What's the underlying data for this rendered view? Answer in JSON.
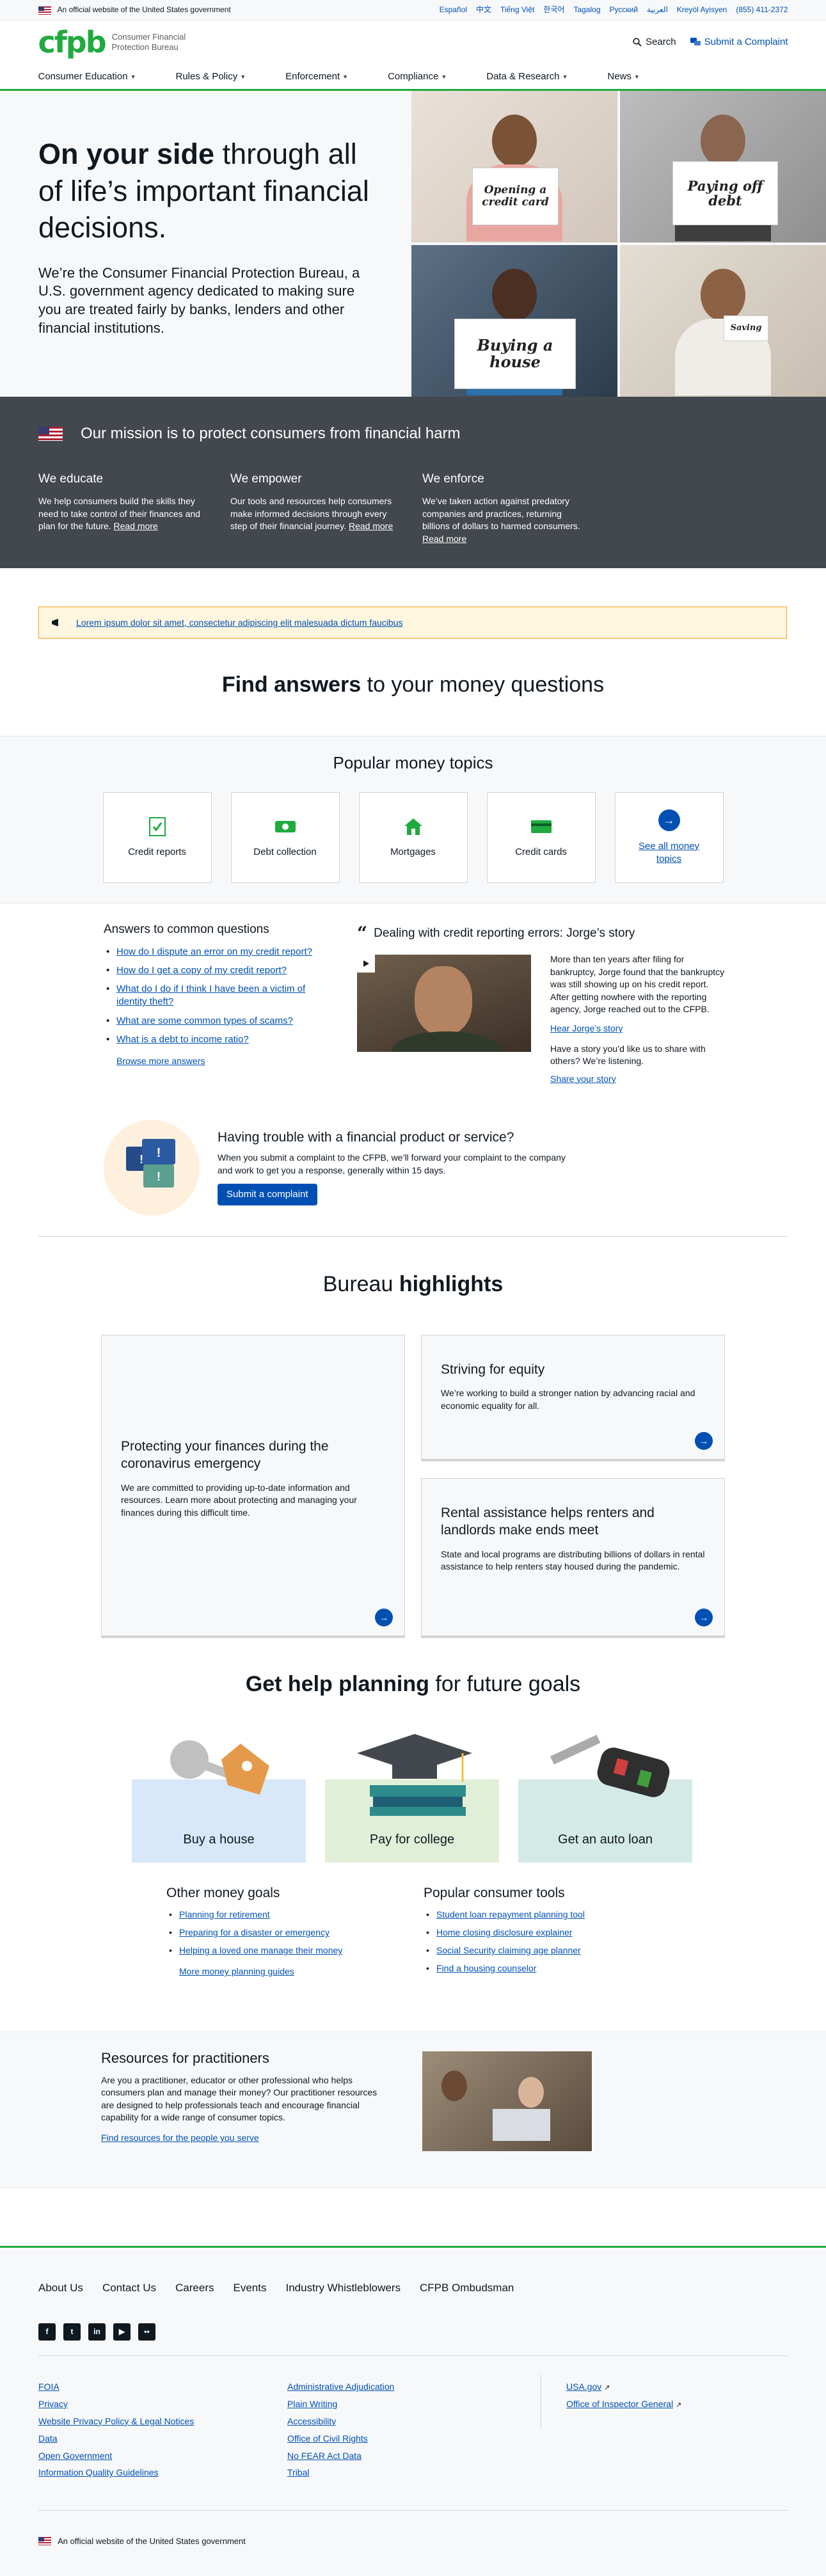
{
  "gov_banner": {
    "text": "An official website of the United States government",
    "languages": [
      "Español",
      "中文",
      "Tiếng Việt",
      "한국어",
      "Tagalog",
      "Русский",
      "العربية",
      "Kreyòl Ayisyen"
    ],
    "phone": "(855) 411-2372"
  },
  "header": {
    "logo": "cfpb",
    "logo_text": "Consumer Financial Protection Bureau",
    "search_label": "Search",
    "complaint_label": "Submit a Complaint",
    "nav": [
      "Consumer Education",
      "Rules & Policy",
      "Enforcement",
      "Compliance",
      "Data & Research",
      "News"
    ]
  },
  "hero": {
    "title_bold": "On your side",
    "title_rest": " through all of life’s important financial decisions.",
    "body": "We’re the Consumer Financial Protection Bureau, a U.S. government agency dedicated to making sure you are treated fairly by banks, lenders and other financial institutions.",
    "signs": [
      "Opening a credit card",
      "Paying off debt",
      "Buying a house",
      "Saving"
    ]
  },
  "mission": {
    "title": "Our mission is to protect consumers from financial harm",
    "columns": [
      {
        "heading": "We educate",
        "body": "We help consumers build the skills they need to take control of their finances and plan for the future.",
        "link": "Read more"
      },
      {
        "heading": "We empower",
        "body": "Our tools and resources help consumers make informed decisions through every step of their financial journey.",
        "link": "Read more"
      },
      {
        "heading": "We enforce",
        "body": "We’ve taken action against predatory companies and practices, returning billions of dollars to harmed consumers.",
        "link": "Read more"
      }
    ]
  },
  "notice": {
    "text": "Lorem ipsum dolor sit amet, consectetur adipiscing elit malesuada dictum faucibus"
  },
  "find_answers": {
    "bold": "Find answers",
    "rest": " to your money questions"
  },
  "topics": {
    "title": "Popular money topics",
    "items": [
      "Credit reports",
      "Debt collection",
      "Mortgages",
      "Credit cards",
      "See all money topics"
    ]
  },
  "answers": {
    "title": "Answers to common questions",
    "items": [
      "How do I dispute an error on my credit report?",
      "How do I get a copy of my credit report?",
      "What do I do if I think I have been a victim of identity theft?",
      "What are some common types of scams?",
      "What is a debt to income ratio?"
    ],
    "more": "Browse more answers"
  },
  "story": {
    "title": "Dealing with credit reporting errors: Jorge’s story",
    "body": "More than ten years after filing for bankruptcy, Jorge found that the bankruptcy was still showing up on his credit report. After getting nowhere with the reporting agency, Jorge reached out to the CFPB.",
    "link": "Hear Jorge’s story",
    "prompt": "Have a story you’d like us to share with others? We’re listening.",
    "share": "Share your story"
  },
  "complaint": {
    "title": "Having trouble with a financial product or service?",
    "body": "When you submit a complaint to the CFPB, we’ll forward your complaint to the company and work to get you a response, generally within 15 days.",
    "button": "Submit a complaint"
  },
  "highlights": {
    "title_plain": "Bureau ",
    "title_bold": "highlights",
    "items": [
      {
        "title": "Protecting your finances during the coronavirus emergency",
        "body": "We are committed to providing up-to-date information and resources. Learn more about protecting and managing your finances during this difficult time."
      },
      {
        "title": "Striving for equity",
        "body": "We’re working to build a stronger nation by advancing racial and economic equality for all."
      },
      {
        "title": "Rental assistance helps renters and landlords make ends meet",
        "body": "State and local programs are distributing billions of dollars in rental assistance to help renters stay housed during the pandemic."
      }
    ]
  },
  "goals": {
    "title_bold": "Get help planning",
    "title_rest": " for future goals",
    "cards": [
      "Buy a house",
      "Pay for college",
      "Get an auto loan"
    ],
    "other_title": "Other money goals",
    "other": [
      "Planning for retirement",
      "Preparing for a disaster or emergency",
      "Helping a loved one manage their money"
    ],
    "other_more": "More money planning guides",
    "tools_title": "Popular consumer tools",
    "tools": [
      "Student loan repayment planning tool",
      "Home closing disclosure explainer",
      "Social Security claiming age planner",
      "Find a housing counselor"
    ]
  },
  "resources": {
    "title": "Resources for practitioners",
    "body": "Are you a practitioner, educator or other professional who helps consumers plan and manage their money? Our practitioner resources are designed to help professionals teach and encourage financial capability for a wide range of consumer topics.",
    "link": "Find resources for the people you serve"
  },
  "footer": {
    "nav": [
      "About Us",
      "Contact Us",
      "Careers",
      "Events",
      "Industry Whistleblowers",
      "CFPB Ombudsman"
    ],
    "col1": [
      "FOIA",
      "Privacy",
      "Website Privacy Policy & Legal Notices",
      "Data",
      "Open Government",
      "Information Quality Guidelines"
    ],
    "col2": [
      "Administrative Adjudication",
      "Plain Writing",
      "Accessibility",
      "Office of Civil Rights",
      "No FEAR Act Data",
      "Tribal"
    ],
    "col3": [
      "USA.gov",
      "Office of Inspector General"
    ],
    "bottom": "An official website of the United States government"
  },
  "colors": {
    "brand_green": "#20aa3f",
    "link_blue": "#0050b4",
    "dark_gray": "#43484e",
    "notice_border": "#ff9e1b"
  }
}
